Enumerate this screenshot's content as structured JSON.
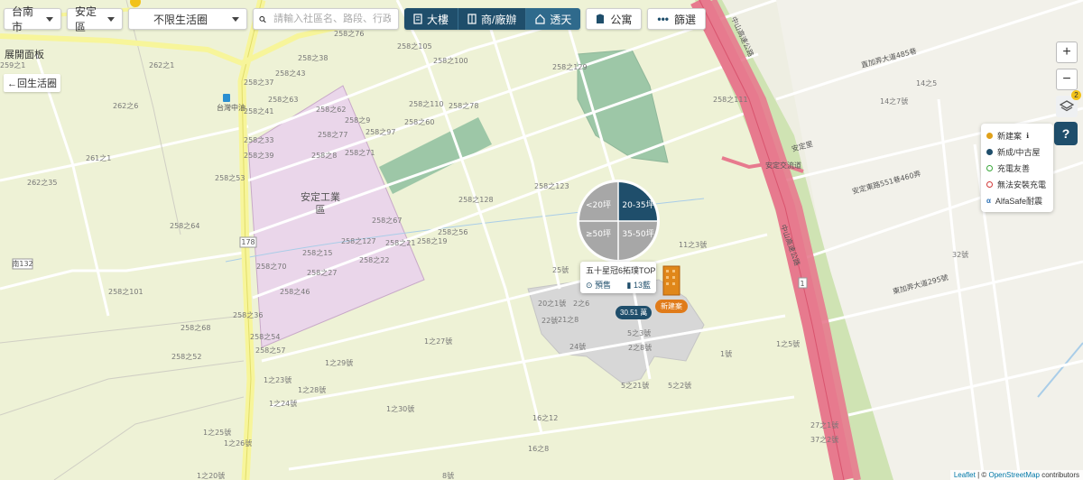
{
  "toolbar": {
    "city": "台南市",
    "district": "安定區",
    "life_circle": "不限生活圈",
    "search_placeholder": "請輸入社區名、路段、行政區",
    "type_buttons": [
      {
        "label": "大樓",
        "icon": "building-icon"
      },
      {
        "label": "商/廠辦",
        "icon": "office-icon"
      },
      {
        "label": "透天",
        "icon": "house-icon"
      },
      {
        "label": "公寓",
        "icon": "apartment-icon"
      }
    ],
    "filter_label": "篩選"
  },
  "side": {
    "expand_panel": "展開面板",
    "back_to_life_circle": "←回生活圈"
  },
  "controls": {
    "zoom_in": "+",
    "zoom_out": "−",
    "layers_badge": "2",
    "help": "?"
  },
  "legend": [
    {
      "label": "新建案",
      "color": "#e0a11a",
      "info": "ℹ"
    },
    {
      "label": "新成/中古屋",
      "color": "#1f4e6b"
    },
    {
      "label": "充電友善",
      "color": "#3aa83a",
      "hollow": true
    },
    {
      "label": "無法安裝充電",
      "color": "#d23a3a",
      "hollow": true
    },
    {
      "label": "AlfaSafe耐震",
      "color": "#2a6fb5"
    }
  ],
  "cluster": {
    "segments": [
      "<20坪",
      "20-35坪",
      "≥50坪",
      "35-50坪"
    ],
    "popup_title": "五十星冠6拓璞TOP",
    "popup_status": "預售",
    "popup_count": "13藍",
    "price": "30.51 萬",
    "new_tag": "新建案"
  },
  "map_labels": {
    "zone": [
      "安定工業",
      "區"
    ],
    "roads": [
      "直加弄大道485巷",
      "安定東路551巷460弄",
      "東加弄大道295號",
      "中山高速公路",
      "中山高速公路",
      "安定交流道",
      "安定里",
      "178",
      "南132",
      "1"
    ],
    "addresses": [
      "258之105",
      "258之76",
      "258之38",
      "258之43",
      "258之37",
      "258之63",
      "258之62",
      "258之9",
      "258之97",
      "258之110",
      "258之78",
      "258之60",
      "258之100",
      "258之129",
      "258之111",
      "258之77",
      "258之71",
      "258之8",
      "258之33",
      "258之39",
      "258之53",
      "258之41",
      "258之67",
      "258之127",
      "258之21",
      "258之19",
      "258之56",
      "258之128",
      "258之123",
      "258之64",
      "258之15",
      "258之27",
      "258之22",
      "258之70",
      "258之46",
      "258之101",
      "258之68",
      "258之52",
      "258之54",
      "258之57",
      "258之36",
      "1之27號",
      "1之29號",
      "1之28號",
      "1之23號",
      "1之24號",
      "1之26號",
      "1之20號",
      "1之25號",
      "16之12",
      "1之30號",
      "5之2號",
      "5之21號",
      "5之3號",
      "1之5號",
      "2之6",
      "21之8",
      "2之8號",
      "27之1號",
      "37之2號",
      "14之5",
      "14之7號",
      "32號",
      "11之3號",
      "25號",
      "20之1號",
      "22號",
      "24號",
      "1號",
      "16之8",
      "8號",
      "262之1",
      "262之6",
      "262之35",
      "261之1",
      "259之1"
    ],
    "station": "台灣中油"
  },
  "attribution": {
    "leaflet": "Leaflet",
    "sep": " | © ",
    "osm": "OpenStreetMap",
    "suffix": " contributors"
  }
}
